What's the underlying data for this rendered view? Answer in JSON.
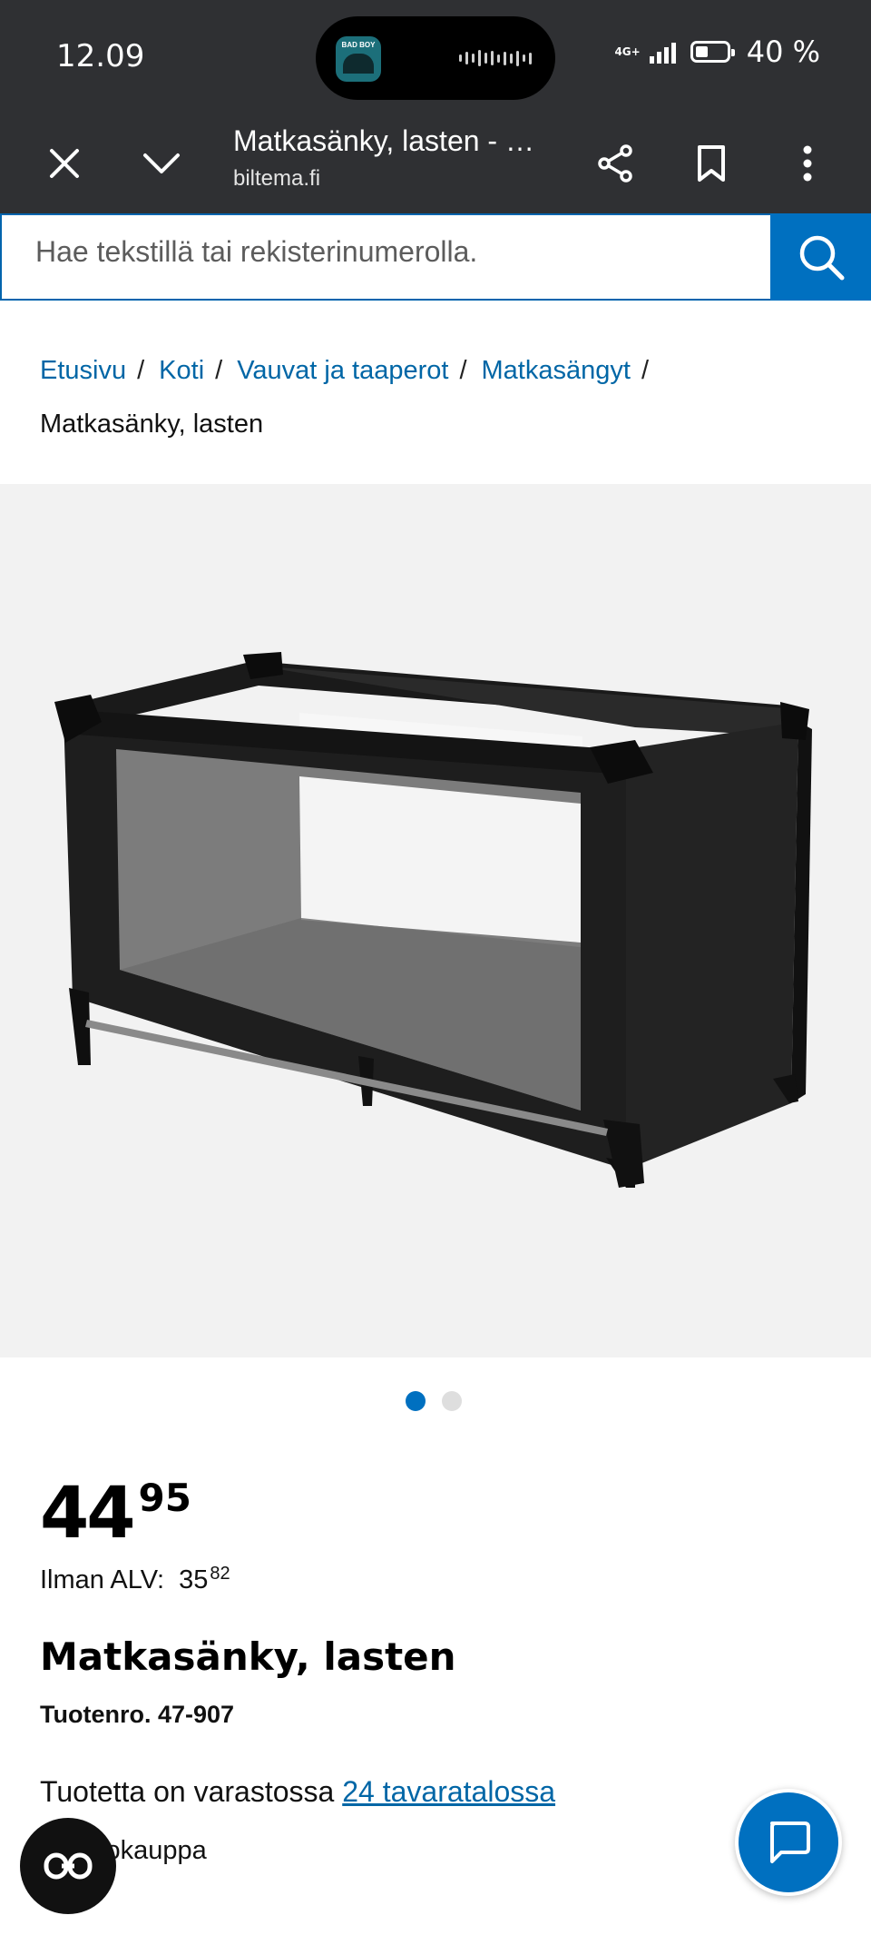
{
  "status_bar": {
    "time": "12.09",
    "island_app_label": "BAD BOY",
    "network": "4G+",
    "battery_percent": "40 %",
    "battery_level": 0.4
  },
  "browser": {
    "page_title": "Matkasänky, lasten - …",
    "url": "biltema.fi",
    "icons": [
      "close-icon",
      "chevron-down-icon",
      "share-icon",
      "bookmark-icon",
      "more-vert-icon"
    ]
  },
  "search": {
    "placeholder": "Hae tekstillä tai rekisterinumerolla.",
    "icon": "search-icon",
    "accent_color": "#0070c0"
  },
  "breadcrumb": {
    "items": [
      "Etusivu",
      "Koti",
      "Vauvat ja taaperot",
      "Matkasängyt"
    ],
    "separator": "/",
    "current": "Matkasänky, lasten"
  },
  "gallery": {
    "image": "black-travel-cot",
    "total_images": 2,
    "active_index": 1
  },
  "product": {
    "price_int": "44",
    "price_dec": "95",
    "vat_label": "Ilman ALV:",
    "vat_int": "35",
    "vat_dec": "82",
    "name": "Matkasänky, lasten",
    "product_number": "Tuotenro. 47-907",
    "stock_text": "Tuotetta on varastossa ",
    "stock_link": "24 tavaratalossa",
    "online_text": "Verkkokauppa"
  },
  "floating": {
    "chat_icon": "chat-bubble-icon",
    "reader_icon": "reader-mode-icon"
  }
}
